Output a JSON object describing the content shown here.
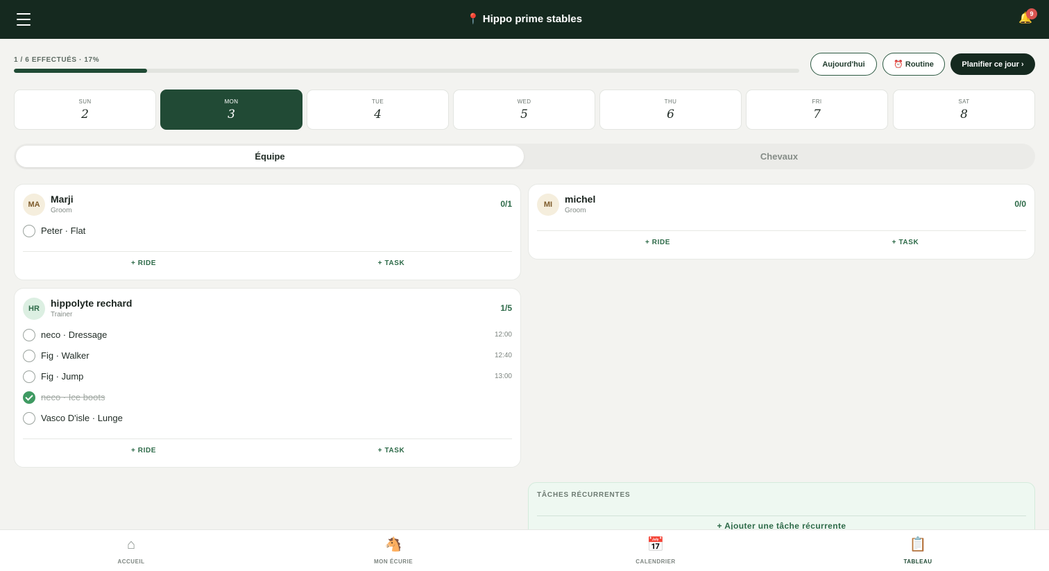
{
  "header": {
    "title": "📍 Hippo prime stables",
    "bell_icon": "bell-icon",
    "notification_count": "9"
  },
  "progress": {
    "label": "1 / 6 EFFECTUÉS · 17%",
    "fraction": 0.17
  },
  "toolbar": {
    "today_label": "Aujourd'hui",
    "routine_label": "⏰ Routine",
    "plan_label": "Planifier ce jour ›"
  },
  "days": [
    {
      "name": "SUN",
      "num": "2",
      "active": false
    },
    {
      "name": "MON",
      "num": "3",
      "active": true
    },
    {
      "name": "TUE",
      "num": "4",
      "active": false
    },
    {
      "name": "WED",
      "num": "5",
      "active": false
    },
    {
      "name": "THU",
      "num": "6",
      "active": false
    },
    {
      "name": "FRI",
      "num": "7",
      "active": false
    },
    {
      "name": "SAT",
      "num": "8",
      "active": false
    }
  ],
  "tabs": {
    "equipe": "Équipe",
    "chevaux": "Chevaux",
    "selected": "Équipe"
  },
  "people": {
    "marji": {
      "initials": "MA",
      "name": "Marji",
      "role": "Groom",
      "count": "0/1",
      "tasks": [
        {
          "label": "Peter · Flat",
          "time": "",
          "done": false
        }
      ]
    },
    "michel": {
      "initials": "MI",
      "name": "michel",
      "role": "Groom",
      "count": "0/0",
      "tasks": []
    },
    "hippolyte": {
      "initials": "HR",
      "name": "hippolyte rechard",
      "role": "Trainer",
      "count": "1/5",
      "tasks": [
        {
          "label": "neco · Dressage",
          "time": "12:00",
          "done": false
        },
        {
          "label": "Fig · Walker",
          "time": "12:40",
          "done": false
        },
        {
          "label": "Fig · Jump",
          "time": "13:00",
          "done": false
        },
        {
          "label": "neco · Ice boots",
          "time": "",
          "done": true
        },
        {
          "label": "Vasco D'isle · Lunge",
          "time": "",
          "done": false
        }
      ]
    }
  },
  "actions": {
    "ride": "+ RIDE",
    "task": "+ TASK"
  },
  "recurring": {
    "title": "TÂCHES RÉCURRENTES",
    "add_label": "+ Ajouter une tâche récurrente"
  },
  "bottom_nav": [
    {
      "label": "ACCUEIL",
      "icon": "⌂",
      "icon_name": "home-icon",
      "active": false
    },
    {
      "label": "MON ÉCURIE",
      "icon": "🐴",
      "icon_name": "horse-icon",
      "active": false
    },
    {
      "label": "CALENDRIER",
      "icon": "📅",
      "icon_name": "calendar-icon",
      "active": false
    },
    {
      "label": "TABLEAU",
      "icon": "📋",
      "icon_name": "clipboard-icon",
      "active": true
    }
  ],
  "colors": {
    "header_bg": "#15291f",
    "accent": "#214a35",
    "success": "#3f9a62",
    "badge": "#d9534f"
  }
}
